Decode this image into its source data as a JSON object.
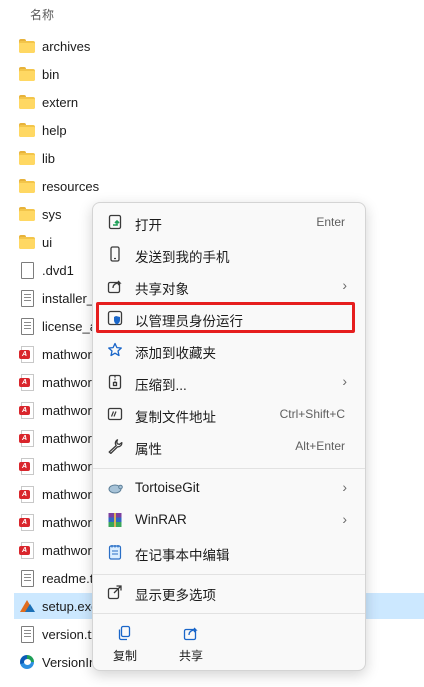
{
  "header": {
    "column_name": "名称",
    "sort_caret": "^"
  },
  "files": [
    {
      "name": "archives",
      "icon": "folder-icon"
    },
    {
      "name": "bin",
      "icon": "folder-icon"
    },
    {
      "name": "extern",
      "icon": "folder-icon"
    },
    {
      "name": "help",
      "icon": "folder-icon"
    },
    {
      "name": "lib",
      "icon": "folder-icon"
    },
    {
      "name": "resources",
      "icon": "folder-icon"
    },
    {
      "name": "sys",
      "icon": "folder-icon"
    },
    {
      "name": "ui",
      "icon": "folder-icon"
    },
    {
      "name": ".dvd1",
      "icon": "document-icon"
    },
    {
      "name": "installer_i",
      "icon": "document-icon"
    },
    {
      "name": "license_ag",
      "icon": "document-icon"
    },
    {
      "name": "mathworl",
      "icon": "pdf-icon"
    },
    {
      "name": "mathworl",
      "icon": "pdf-icon"
    },
    {
      "name": "mathworl",
      "icon": "pdf-icon"
    },
    {
      "name": "mathworl",
      "icon": "pdf-icon"
    },
    {
      "name": "mathworl",
      "icon": "pdf-icon"
    },
    {
      "name": "mathworl",
      "icon": "pdf-icon"
    },
    {
      "name": "mathworl",
      "icon": "pdf-icon"
    },
    {
      "name": "mathworl",
      "icon": "pdf-icon"
    },
    {
      "name": "readme.t",
      "icon": "document-icon"
    },
    {
      "name": "setup.exe",
      "icon": "matlab-setup-icon",
      "selected": true
    },
    {
      "name": "version.tx",
      "icon": "document-icon"
    },
    {
      "name": "VersionIn",
      "icon": "edge-icon"
    }
  ],
  "context_menu": {
    "items": [
      {
        "label": "打开",
        "shortcut": "Enter",
        "icon": "open-icon"
      },
      {
        "label": "发送到我的手机",
        "icon": "phone-icon"
      },
      {
        "label": "共享对象",
        "icon": "share-icon",
        "submenu": true
      },
      {
        "label": "以管理员身份运行",
        "icon": "admin-shield-icon",
        "highlighted": true
      },
      {
        "label": "添加到收藏夹",
        "icon": "star-icon"
      },
      {
        "label": "压缩到...",
        "icon": "archive-icon",
        "submenu": true
      },
      {
        "label": "复制文件地址",
        "shortcut": "Ctrl+Shift+C",
        "icon": "copy-path-icon"
      },
      {
        "label": "属性",
        "shortcut": "Alt+Enter",
        "icon": "wrench-icon"
      },
      {
        "label": "TortoiseGit",
        "icon": "tortoisegit-icon",
        "submenu": true
      },
      {
        "label": "WinRAR",
        "icon": "winrar-icon",
        "submenu": true
      },
      {
        "label": "在记事本中编辑",
        "icon": "notepad-icon"
      },
      {
        "label": "显示更多选项",
        "icon": "more-options-icon"
      }
    ],
    "bottom_actions": [
      {
        "label": "复制",
        "icon": "copy-icon"
      },
      {
        "label": "共享",
        "icon": "share-icon"
      }
    ],
    "submenu_glyph": "›"
  },
  "colors": {
    "highlight_border": "#e61e1e",
    "selection": "#cce8ff",
    "folder": "#ffd863",
    "pdf": "#d9262c"
  }
}
